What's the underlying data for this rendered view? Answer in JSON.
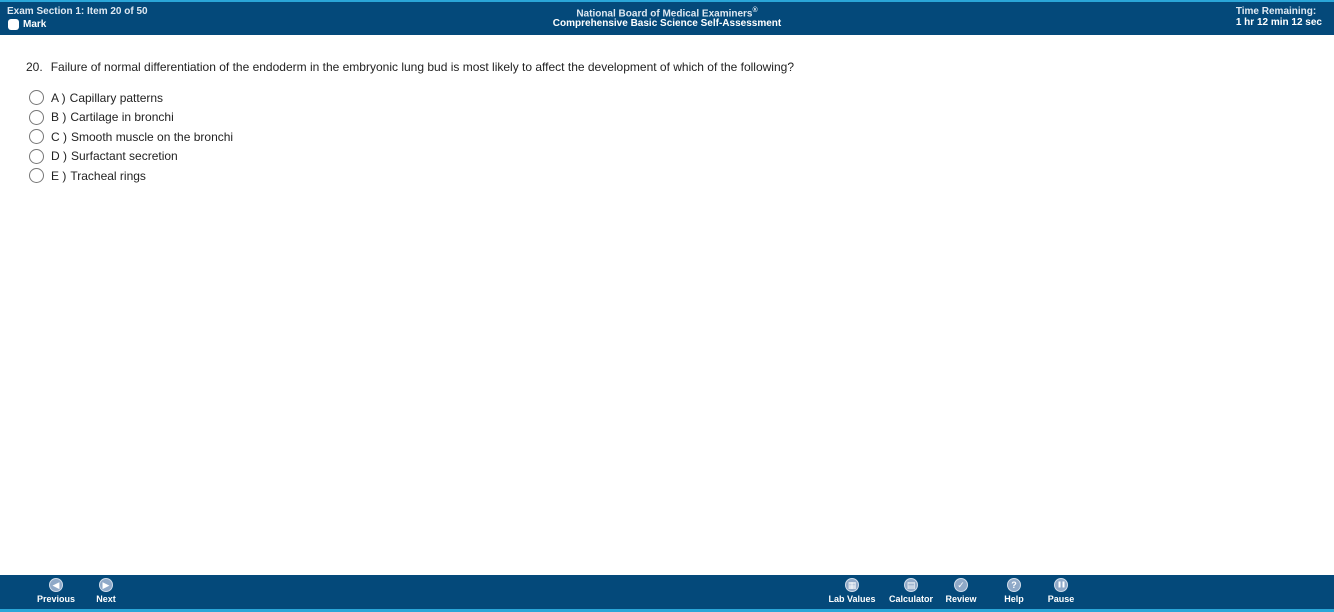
{
  "header": {
    "section_item": "Exam Section 1: Item 20 of 50",
    "mark_label": "Mark",
    "org_name": "National Board of Medical Examiners",
    "org_reg": "®",
    "exam_title": "Comprehensive Basic Science Self-Assessment",
    "time_label": "Time Remaining:",
    "time_value": "1 hr 12 min 12 sec"
  },
  "question": {
    "number": "20.",
    "text": "Failure of normal differentiation of the endoderm in the embryonic lung bud is most likely to affect the development of which of the following?",
    "options": [
      {
        "letter": "A )",
        "text": "Capillary patterns"
      },
      {
        "letter": "B )",
        "text": "Cartilage in bronchi"
      },
      {
        "letter": "C )",
        "text": "Smooth muscle on the bronchi"
      },
      {
        "letter": "D )",
        "text": "Surfactant secretion"
      },
      {
        "letter": "E )",
        "text": "Tracheal rings"
      }
    ]
  },
  "footer": {
    "previous": {
      "label": "Previous",
      "icon": "◀"
    },
    "next": {
      "label": "Next",
      "icon": "▶"
    },
    "lab_values": {
      "label": "Lab Values",
      "icon": "▦"
    },
    "calculator": {
      "label": "Calculator",
      "icon": "▤"
    },
    "review": {
      "label": "Review",
      "icon": "✓"
    },
    "help": {
      "label": "Help",
      "icon": "?"
    },
    "pause": {
      "label": "Pause",
      "icon": "❚❚"
    }
  },
  "colors": {
    "bar_background": "#04497a",
    "bar_accent": "#2aa6d8",
    "icon_fill": "#8fa9c8"
  }
}
